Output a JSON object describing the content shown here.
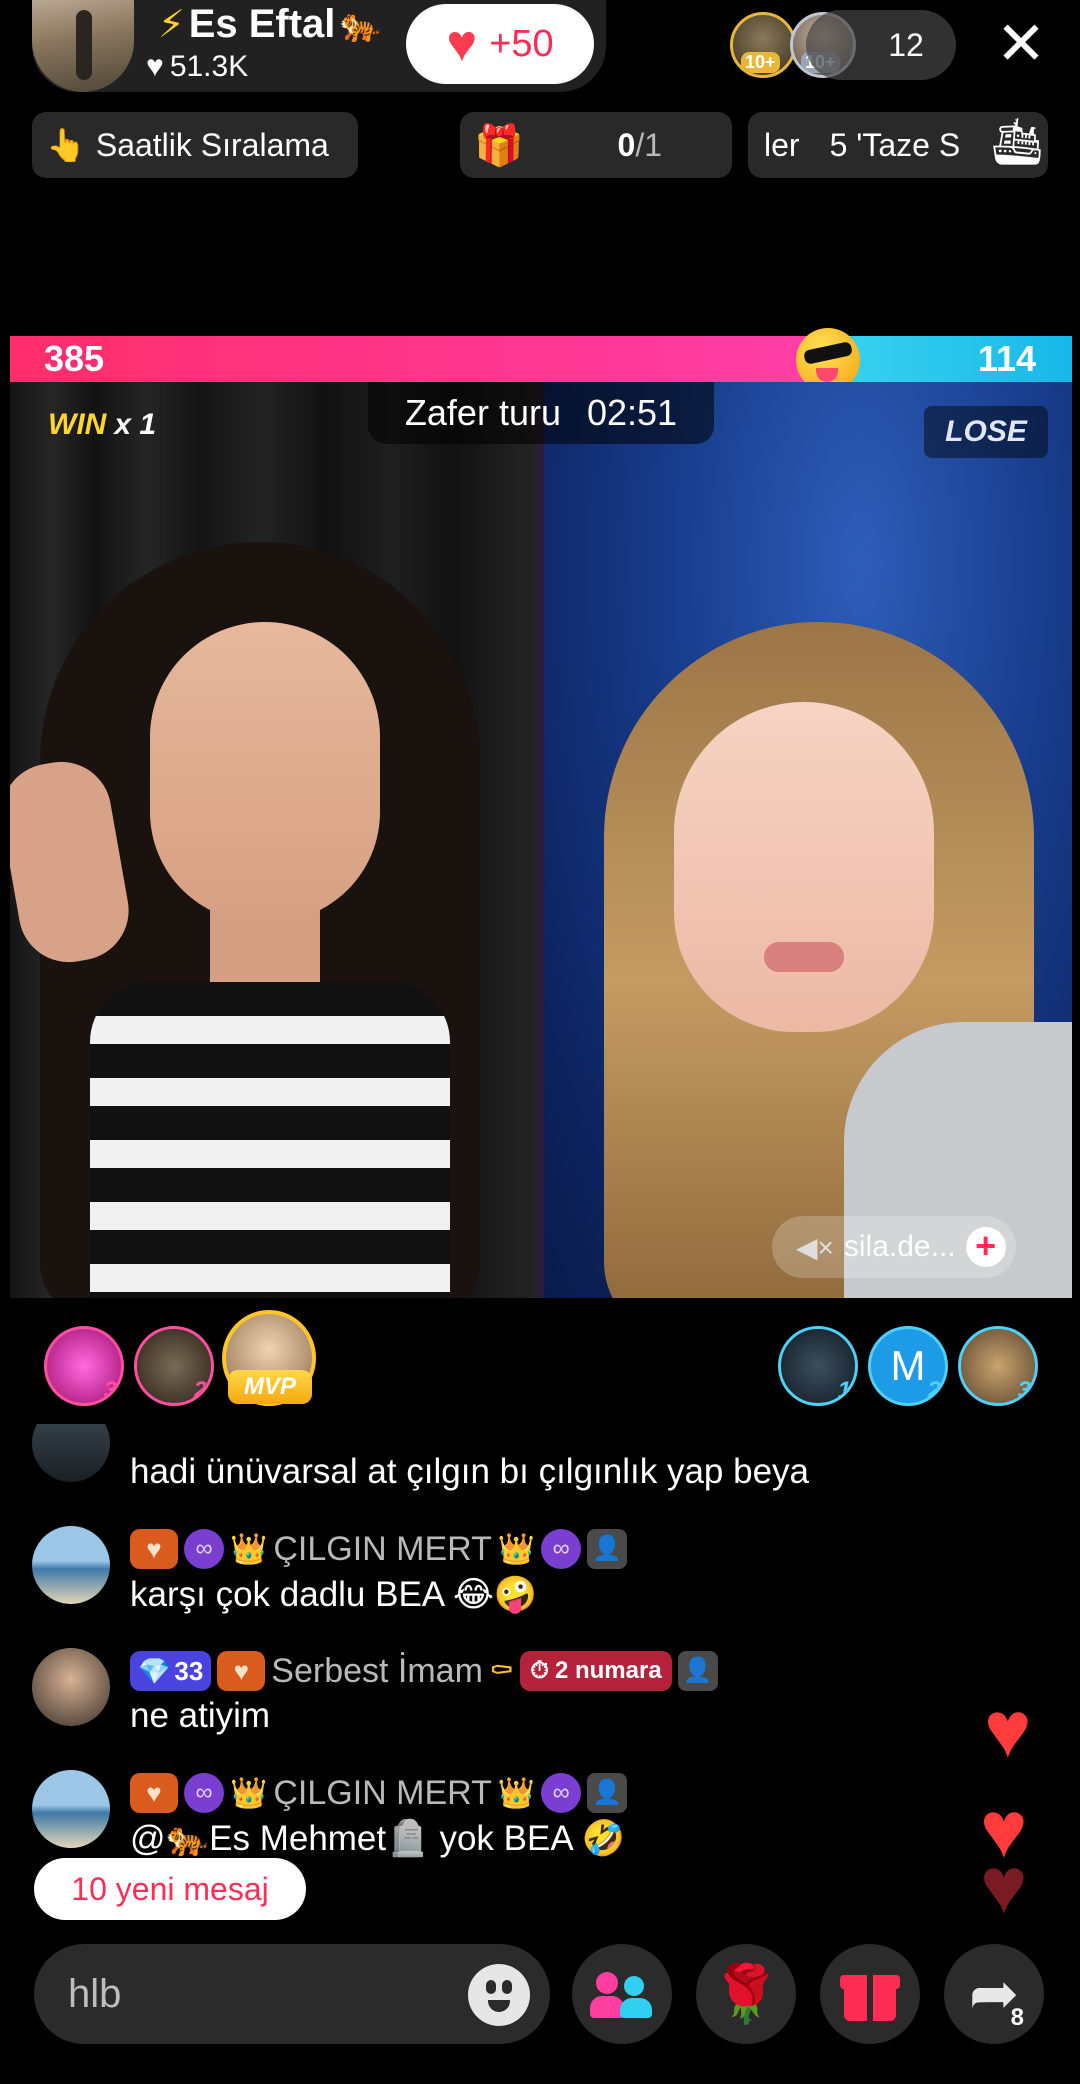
{
  "header": {
    "host_name": "Es Eftal",
    "host_likes": "51.3K",
    "follow_label": "+50",
    "viewer_count": "12",
    "viewer_badges": [
      "10+",
      "10+"
    ]
  },
  "chips": {
    "ranking_label": "Saatlik Sıralama",
    "goal_current": "0",
    "goal_total": "/1",
    "promo_left": "ler",
    "promo_right": "5 'Taze S"
  },
  "battle": {
    "score_left": "385",
    "score_right": "114",
    "score_share_left": 0.77,
    "win_word": "WIN",
    "win_multiplier": "x 1",
    "round_label": "Zafer turu",
    "timer": "02:51",
    "lose_word": "LOSE",
    "opponent_name": "sila.de..."
  },
  "supporters": {
    "left": [
      "3",
      "2"
    ],
    "mvp_label": "MVP",
    "right": [
      "1",
      "2",
      "3"
    ],
    "right_initial": "M"
  },
  "chat": {
    "messages": [
      {
        "name": "",
        "text": "hadi ünüvarsal at çılgın bı çılgınlık yap beya"
      },
      {
        "name": "ÇILGIN MERT",
        "text": "karşı çok dadlu BEA 😂🤪"
      },
      {
        "name": "Serbest İmam",
        "gem_level": "33",
        "rank": "2 numara",
        "text": "ne atiyim"
      },
      {
        "name": "ÇILGIN MERT",
        "text_prefix": "@",
        "mention": "Es Mehmet",
        "text_suffix": " yok BEA 🤣"
      }
    ],
    "new_messages_label": "10 yeni mesaj"
  },
  "bottom": {
    "input_value": "hlb",
    "share_count": "8"
  },
  "colors": {
    "accent_pink": "#ff2d55",
    "team_red": "#ff2d6a",
    "team_blue": "#18b7e8",
    "gold": "#ffc52a"
  },
  "icons": [
    "lightning-icon",
    "tiger-icon",
    "heart-icon",
    "close-icon",
    "hand-icon",
    "gift-icon",
    "ship-icon",
    "emoji-icon",
    "guests-icon",
    "rose-icon",
    "share-icon"
  ]
}
